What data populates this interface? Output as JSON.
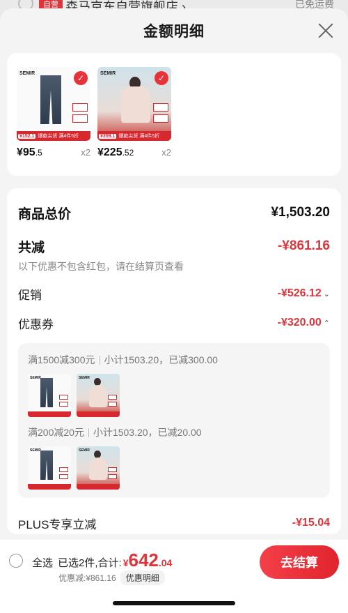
{
  "background": {
    "badge": "自营",
    "store_name": "森马京东自营旗舰店 ›",
    "shipping": "已免运费"
  },
  "sheet": {
    "title": "金额明细"
  },
  "products": [
    {
      "brand": "SEMIR",
      "price_main": "¥95",
      "price_dec": ".5",
      "qty": "x2",
      "promo_price": "¥152.1",
      "promo_text": "爆款尖货 满4件5折"
    },
    {
      "brand": "SEMIR",
      "price_main": "¥225",
      "price_dec": ".52",
      "qty": "x2",
      "promo_price": "¥359.1",
      "promo_text": "爆款尖货 满4件5折"
    }
  ],
  "details": {
    "total_label": "商品总价",
    "total_value": "¥1,503.20",
    "reduce_label": "共减",
    "reduce_value": "-¥861.16",
    "reduce_note": "以下优惠不包含红包，请在结算页查看",
    "promo_label": "促销",
    "promo_value": "-¥526.12",
    "coupon_label": "优惠券",
    "coupon_value": "-¥320.00",
    "coupons": [
      {
        "title": "满1500减300元",
        "subtotal": "小计1503.20，已减300.00"
      },
      {
        "title": "满200减20元",
        "subtotal": "小计1503.20，已减20.00"
      }
    ],
    "plus_label": "PLUS专享立减",
    "plus_value": "-¥15.04"
  },
  "bottom": {
    "select_all": "全选",
    "selected": "已选2件,合计:",
    "currency": "¥",
    "total_main": "642",
    "total_dec": ".04",
    "discount_text": "优惠减:¥861.16",
    "detail_pill": "优惠明细",
    "checkout": "去结算"
  },
  "colors": {
    "accent_red": "#e0343b",
    "page_bg": "#f4f4f4"
  }
}
